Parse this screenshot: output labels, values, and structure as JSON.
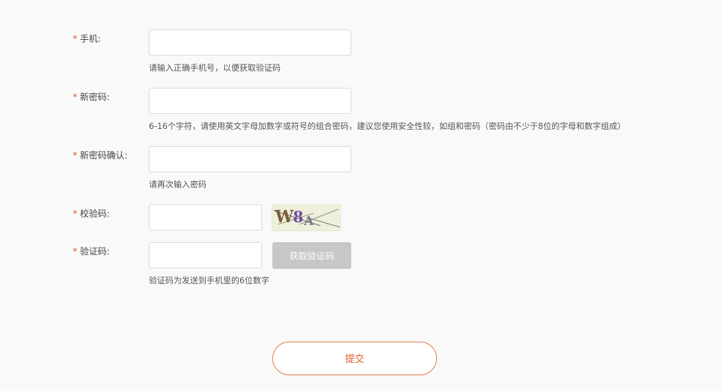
{
  "form": {
    "required_mark": "*",
    "phone": {
      "label": "手机:",
      "value": "",
      "hint": "请输入正确手机号，以便获取验证码"
    },
    "new_password": {
      "label": "新密码:",
      "value": "",
      "hint": "6-16个字符，请使用英文字母加数字或符号的组合密码，建议您使用安全性较，如组和密码（密码由不少于8位的字母和数字组成）"
    },
    "confirm_password": {
      "label": "新密码确认:",
      "value": "",
      "hint": "请再次输入密码"
    },
    "check_code": {
      "label": "校验码:",
      "value": "",
      "captcha_text": [
        "W",
        "8",
        "A"
      ]
    },
    "sms_code": {
      "label": "验证码:",
      "value": "",
      "button_label": "获取验证码",
      "hint": "验证码为发送到手机里的6位数字"
    },
    "submit_label": "提交"
  },
  "colors": {
    "accent": "#e25c26",
    "required": "#e4572e",
    "disabled_button": "#c9c6c6",
    "captcha_bg": "#eef0dc"
  }
}
